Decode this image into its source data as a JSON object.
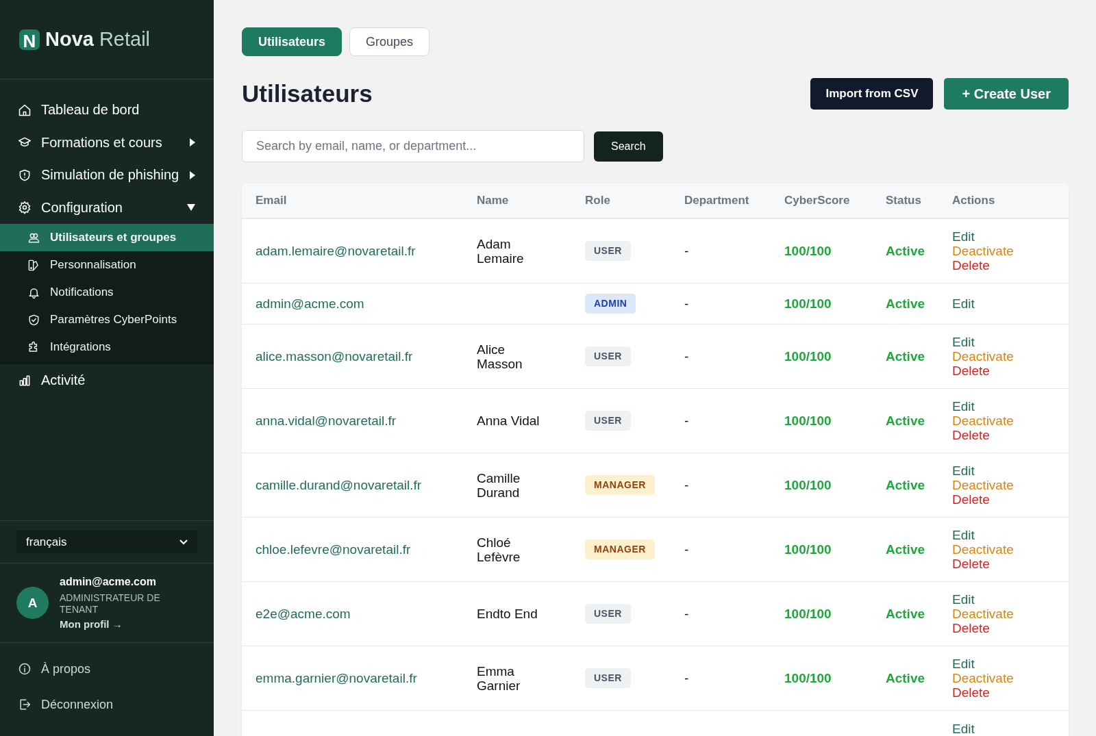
{
  "brand": {
    "mark": "N",
    "name": "Nova",
    "suffix": "Retail"
  },
  "nav": [
    {
      "label": "Tableau de bord",
      "kind": "link"
    },
    {
      "label": "Formations et cours",
      "kind": "group",
      "expanded": false
    },
    {
      "label": "Simulation de phishing",
      "kind": "group",
      "expanded": false
    },
    {
      "label": "Configuration",
      "kind": "group",
      "expanded": true,
      "children": [
        {
          "label": "Utilisateurs et groupes",
          "selected": true
        },
        {
          "label": "Personnalisation",
          "selected": false
        },
        {
          "label": "Notifications",
          "selected": false
        },
        {
          "label": "Paramètres CyberPoints",
          "selected": false
        },
        {
          "label": "Intégrations",
          "selected": false
        }
      ]
    },
    {
      "label": "Activité",
      "kind": "link"
    }
  ],
  "language": {
    "value": "français"
  },
  "user": {
    "initial": "A",
    "email": "admin@acme.com",
    "role": "ADMINISTRATEUR DE TENANT",
    "profile_link": "Mon profil →"
  },
  "footer_links": [
    "À propos",
    "Déconnexion"
  ],
  "tabs": [
    {
      "label": "Utilisateurs",
      "selected": true
    },
    {
      "label": "Groupes",
      "selected": false
    }
  ],
  "title": "Utilisateurs",
  "buttons": [
    {
      "label": "Import from CSV",
      "kind": "dark"
    },
    {
      "label": "+ Create User",
      "kind": "primary"
    }
  ],
  "search": {
    "placeholder": "Search by email, name, or department...",
    "button": "Search"
  },
  "table": {
    "columns": [
      "Email",
      "Name",
      "Role",
      "Department",
      "CyberScore",
      "Status",
      "Actions"
    ],
    "rows": [
      {
        "email": "adam.lemaire@novaretail.fr",
        "name": "Adam Lemaire",
        "role": {
          "label": "USER",
          "kind": "user"
        },
        "department": "-",
        "score": "100/100",
        "status": "Active",
        "actions": [
          {
            "label": "Edit",
            "kind": "edit"
          },
          {
            "label": "Deactivate",
            "kind": "deactivate"
          },
          {
            "label": "Delete",
            "kind": "delete"
          }
        ]
      },
      {
        "email": "admin@acme.com",
        "role": {
          "label": "ADMIN",
          "kind": "admin"
        },
        "department": "-",
        "score": "100/100",
        "status": "Active",
        "actions": [
          {
            "label": "Edit",
            "kind": "edit"
          }
        ]
      },
      {
        "email": "alice.masson@novaretail.fr",
        "name": "Alice Masson",
        "role": {
          "label": "USER",
          "kind": "user"
        },
        "department": "-",
        "score": "100/100",
        "status": "Active",
        "actions": [
          {
            "label": "Edit",
            "kind": "edit"
          },
          {
            "label": "Deactivate",
            "kind": "deactivate"
          },
          {
            "label": "Delete",
            "kind": "delete"
          }
        ]
      },
      {
        "email": "anna.vidal@novaretail.fr",
        "name": "Anna Vidal",
        "role": {
          "label": "USER",
          "kind": "user"
        },
        "department": "-",
        "score": "100/100",
        "status": "Active",
        "actions": [
          {
            "label": "Edit",
            "kind": "edit"
          },
          {
            "label": "Deactivate",
            "kind": "deactivate"
          },
          {
            "label": "Delete",
            "kind": "delete"
          }
        ]
      },
      {
        "email": "camille.durand@novaretail.fr",
        "name": "Camille Durand",
        "role": {
          "label": "MANAGER",
          "kind": "manager"
        },
        "department": "-",
        "score": "100/100",
        "status": "Active",
        "actions": [
          {
            "label": "Edit",
            "kind": "edit"
          },
          {
            "label": "Deactivate",
            "kind": "deactivate"
          },
          {
            "label": "Delete",
            "kind": "delete"
          }
        ]
      },
      {
        "email": "chloe.lefevre@novaretail.fr",
        "name": "Chloé Lefèvre",
        "role": {
          "label": "MANAGER",
          "kind": "manager"
        },
        "department": "-",
        "score": "100/100",
        "status": "Active",
        "actions": [
          {
            "label": "Edit",
            "kind": "edit"
          },
          {
            "label": "Deactivate",
            "kind": "deactivate"
          },
          {
            "label": "Delete",
            "kind": "delete"
          }
        ]
      },
      {
        "email": "e2e@acme.com",
        "name": "Endto End",
        "role": {
          "label": "USER",
          "kind": "user"
        },
        "department": "-",
        "score": "100/100",
        "status": "Active",
        "actions": [
          {
            "label": "Edit",
            "kind": "edit"
          },
          {
            "label": "Deactivate",
            "kind": "deactivate"
          },
          {
            "label": "Delete",
            "kind": "delete"
          }
        ]
      },
      {
        "email": "emma.garnier@novaretail.fr",
        "name": "Emma Garnier",
        "role": {
          "label": "USER",
          "kind": "user"
        },
        "department": "-",
        "score": "100/100",
        "status": "Active",
        "actions": [
          {
            "label": "Edit",
            "kind": "edit"
          },
          {
            "label": "Deactivate",
            "kind": "deactivate"
          },
          {
            "label": "Delete",
            "kind": "delete"
          }
        ]
      },
      {
        "actions": [
          {
            "label": "Edit",
            "kind": "edit"
          }
        ]
      }
    ]
  }
}
